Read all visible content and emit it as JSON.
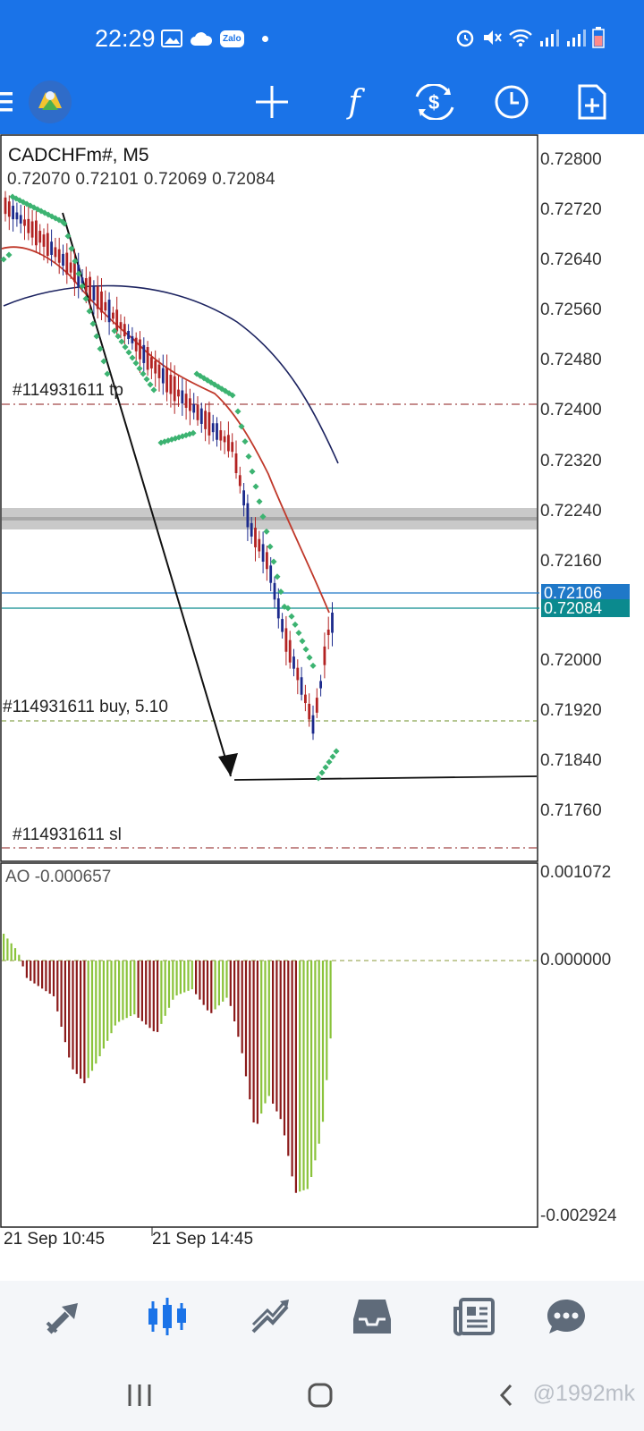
{
  "status_bar": {
    "time": "22:29",
    "left_icons": [
      "image-icon",
      "cloud-icon",
      "zalo-icon",
      "dot-icon"
    ],
    "zalo_label": "Zalo",
    "right_icons": [
      "alarm-icon",
      "mute-icon",
      "wifi-icon",
      "signal-icon",
      "signal-icon",
      "battery-icon"
    ]
  },
  "toolbar": {
    "buttons": [
      "menu-icon",
      "metatrader-logo",
      "crosshair-icon",
      "indicators-icon",
      "trade-icon",
      "timeframe-icon",
      "new-order-icon"
    ],
    "indicator_glyph": "f"
  },
  "chart": {
    "symbol": "CADCHFm#, M5",
    "ohlc": "0.72070 0.72101 0.72069 0.72084",
    "price_labels": [
      "0.72800",
      "0.72720",
      "0.72640",
      "0.72560",
      "0.72480",
      "0.72400",
      "0.72320",
      "0.72240",
      "0.72160",
      "0.72000",
      "0.71920",
      "0.71840",
      "0.71760"
    ],
    "ask_tag": "0.72106",
    "bid_tag": "0.72084",
    "order_tp": "#114931611 tp",
    "order_buy": "#114931611 buy, 5.10",
    "order_sl": "#114931611 sl",
    "ao_label": "AO -0.000657",
    "ao_labels": [
      "0.001072",
      "0.000000",
      "-0.002924"
    ],
    "time_labels": [
      "21 Sep 10:45",
      "21 Sep 14:45"
    ],
    "colors": {
      "ask": "#1f78c8",
      "bid": "#0b8a8e",
      "sar": "#3cb371",
      "ma": "#c0392b",
      "ao_up": "#8ac33b",
      "ao_down": "#8b1a1a",
      "bull": "#1c2a8c",
      "bear": "#b22222"
    }
  },
  "bottom_nav": {
    "items": [
      "quotes-icon",
      "chart-icon",
      "trade-icon",
      "history-icon",
      "news-icon",
      "chat-icon"
    ],
    "active": "chart-icon"
  },
  "system_nav": {
    "items": [
      "recents-icon",
      "home-icon",
      "back-icon"
    ],
    "watermark": "@1992mk"
  }
}
